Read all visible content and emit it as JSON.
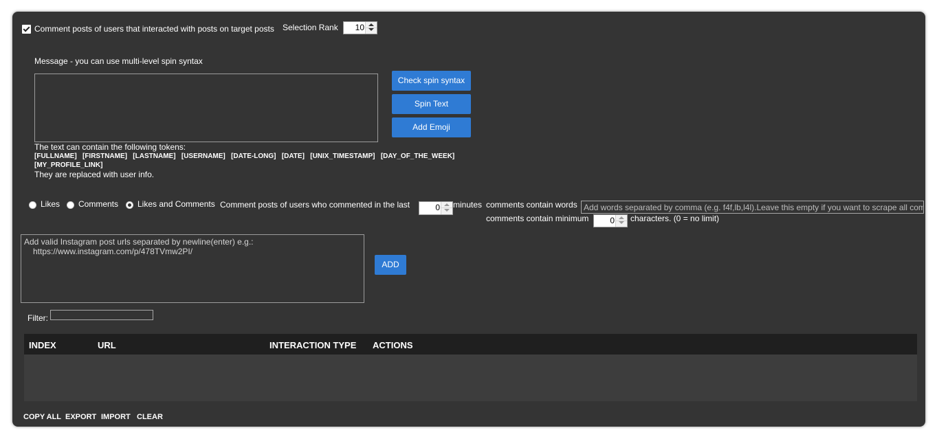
{
  "top": {
    "comment_interacted_label": "Comment posts of users that interacted with posts on target posts",
    "comment_interacted_checked": true,
    "selection_rank_label": "Selection Rank",
    "selection_rank_value": "10"
  },
  "message": {
    "label": "Message - you can use multi-level spin syntax",
    "value": "",
    "check_spin_label": "Check spin syntax",
    "spin_text_label": "Spin Text",
    "add_emoji_label": "Add Emoji",
    "tokens_intro": "The text can contain the following tokens:",
    "tokens_line1": "[FULLNAME]   [FIRSTNAME]   [LASTNAME]   [USERNAME]   [DATE-LONG]   [DATE]   [UNIX_TIMESTAMP]   [DAY_OF_THE_WEEK]",
    "tokens_line2": "[MY_PROFILE_LINK]",
    "tokens_outro": "They are replaced with user info."
  },
  "interaction": {
    "likes_label": "Likes",
    "comments_label": "Comments",
    "likes_and_comments_label": "Likes and Comments",
    "selected": "Likes and Comments",
    "commented_last_label": "Comment posts of users who commented in the last",
    "minutes_value": "0",
    "minutes_label": "minutes",
    "contain_words_label": "comments contain words",
    "contain_words_placeholder": "Add words separated by comma (e.g. f4f,lb,l4l).Leave this empty if you want to scrape all com",
    "contain_min_label": "comments contain minimum",
    "contain_min_value": "0",
    "characters_label": "characters. (0 = no limit)"
  },
  "urls": {
    "placeholder_line1": "Add valid Instagram post urls separated by newline(enter) e.g.:",
    "placeholder_line2": "https://www.instagram.com/p/478TVmw2PI/",
    "add_label": "ADD"
  },
  "filter": {
    "label": "Filter:",
    "value": ""
  },
  "table": {
    "columns": [
      "INDEX",
      "URL",
      "INTERACTION TYPE",
      "ACTIONS"
    ],
    "rows": []
  },
  "footer": {
    "copy_all": "COPY ALL",
    "export": "EXPORT",
    "import": "IMPORT",
    "clear": "CLEAR"
  },
  "colors": {
    "panel_bg": "#343434",
    "accent": "#2f7bd4",
    "table_header_bg": "#1f1f1f",
    "table_body_bg": "#3d3d3d"
  }
}
